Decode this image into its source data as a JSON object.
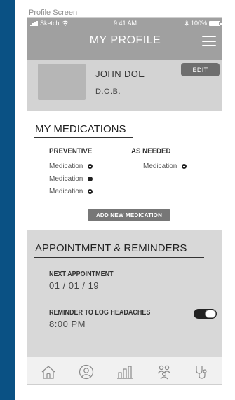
{
  "canvas": {
    "label": "Profile Screen"
  },
  "status_bar": {
    "carrier": "Sketch",
    "time": "9:41 AM",
    "battery": "100%"
  },
  "header": {
    "title": "MY PROFILE",
    "menu_icon": "hamburger-menu-icon"
  },
  "profile": {
    "name": "JOHN DOE",
    "dob": "D.O.B.",
    "edit_label": "EDIT"
  },
  "medications": {
    "title": "MY MEDICATIONS",
    "preventive": {
      "label": "PREVENTIVE",
      "items": [
        "Medication",
        "Medication",
        "Medication"
      ]
    },
    "as_needed": {
      "label": "AS NEEDED",
      "items": [
        "Medication"
      ]
    },
    "add_label": "ADD NEW MEDICATION"
  },
  "appointments": {
    "title": "APPOINTMENT & REMINDERS",
    "next_label": "NEXT APPOINTMENT",
    "next_date": "01 / 01 / 19",
    "reminder_label": "REMINDER TO LOG HEADACHES",
    "reminder_time": "8:00 PM",
    "reminder_enabled": true
  },
  "tab_bar": {
    "items": [
      {
        "icon": "home-icon"
      },
      {
        "icon": "profile-icon"
      },
      {
        "icon": "bar-chart-icon"
      },
      {
        "icon": "people-icon"
      },
      {
        "icon": "stethoscope-icon"
      }
    ]
  },
  "colors": {
    "background": "#0a5184",
    "header": "#a0a0a0",
    "profile_panel": "#d3d3d3",
    "appointments_panel": "#d8d8d8",
    "button": "#6e6e6e"
  }
}
